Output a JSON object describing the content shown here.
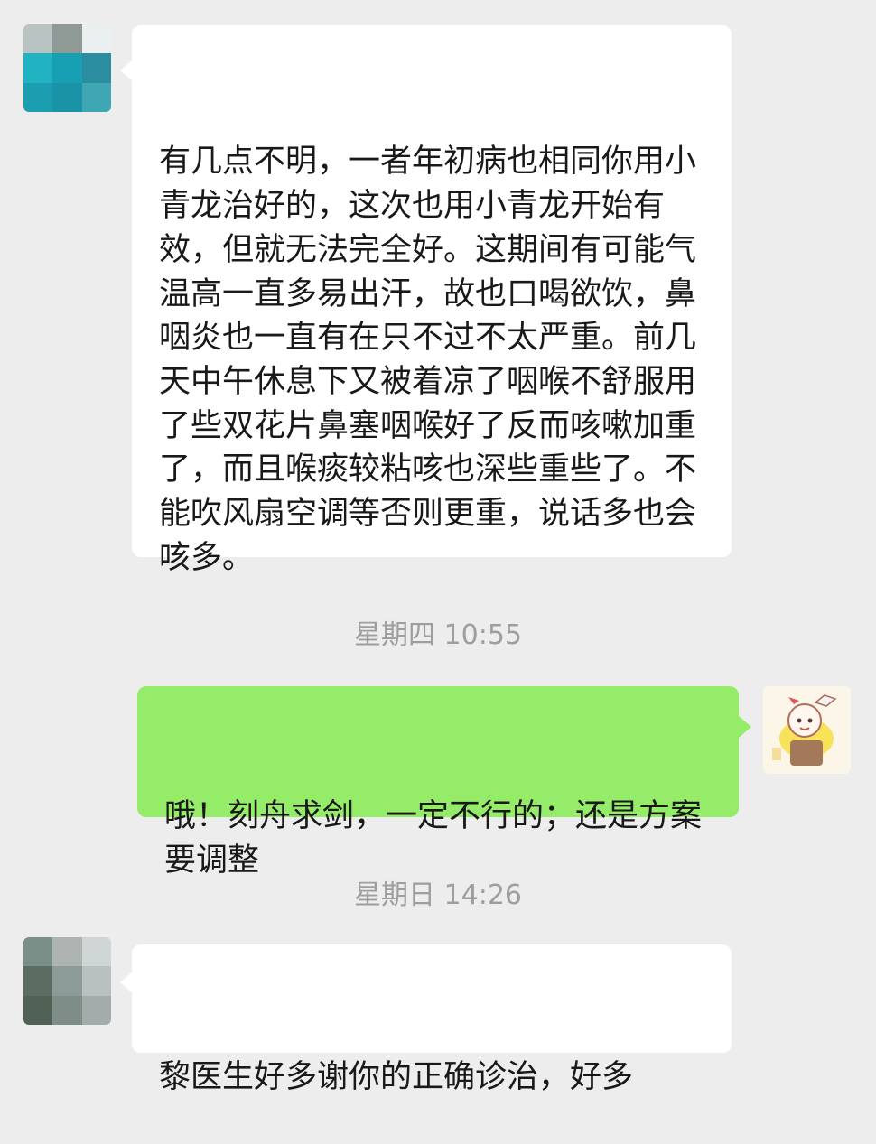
{
  "chat": {
    "messages": [
      {
        "side": "incoming",
        "text": "有几点不明，一者年初病也相同你用小青龙治好的，这次也用小青龙开始有效，但就无法完全好。这期间有可能气温高一直多易出汗，故也口喝欲饮，鼻咽炎也一直有在只不过不太严重。前几天中午休息下又被着凉了咽喉不舒服用了些双花片鼻塞咽喉好了反而咳嗽加重了，而且喉痰较粘咳也深些重些了。不能吹风扇空调等否则更重，说话多也会咳多。"
      },
      {
        "side": "outgoing",
        "text": "哦！刻舟求剑，一定不行的；还是方案要调整"
      },
      {
        "side": "incoming",
        "text": "黎医生好多谢你的正确诊治，好多"
      }
    ],
    "timestamps": [
      "星期四 10:55",
      "星期日 14:26"
    ]
  }
}
